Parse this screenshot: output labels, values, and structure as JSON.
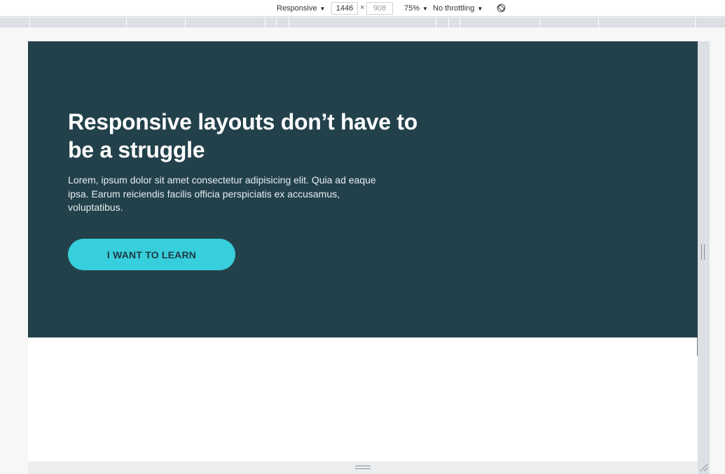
{
  "devtools": {
    "device_mode": "Responsive",
    "width_value": "1446",
    "times_sign": "×",
    "height_value": "908",
    "zoom": "75%",
    "throttling": "No throttling",
    "rotate_icon": "rotate-icon"
  },
  "page": {
    "hero": {
      "title": "Responsive layouts don’t have to be a struggle",
      "body": "Lorem, ipsum dolor sit amet consectetur adipisicing elit. Quia ad eaque ipsa. Earum reiciendis facilis officia perspiciatis ex accusamus, voluptatibus.",
      "button_label": "I WANT TO LEARN"
    }
  },
  "colors": {
    "hero_background": "#23414b",
    "button_background": "#38cfdc",
    "button_text": "#1e3a44"
  }
}
